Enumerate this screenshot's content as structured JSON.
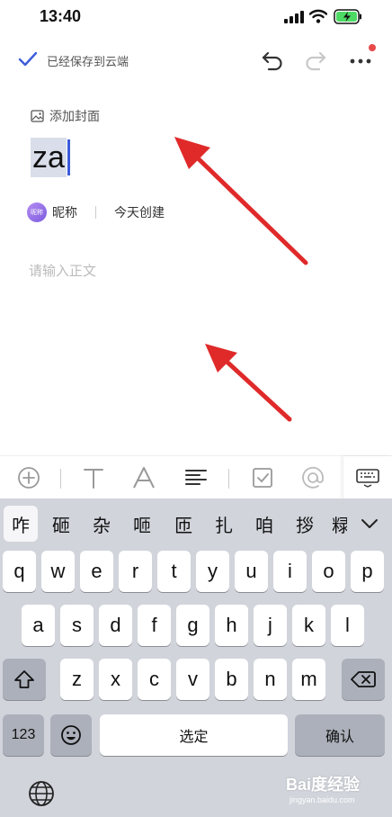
{
  "status_bar": {
    "time": "13:40"
  },
  "toolbar": {
    "save_status": "已经保存到云端"
  },
  "document": {
    "add_cover": "添加封面",
    "title": "za",
    "author_avatar_text": "昵称",
    "author_name": "昵称",
    "created": "今天创建",
    "body_placeholder": "请输入正文"
  },
  "keyboard": {
    "candidates": [
      "咋",
      "砸",
      "杂",
      "咂",
      "匝",
      "扎",
      "咱",
      "拶",
      "粶"
    ],
    "row1": [
      "q",
      "w",
      "e",
      "r",
      "t",
      "y",
      "u",
      "i",
      "o",
      "p"
    ],
    "row2": [
      "a",
      "s",
      "d",
      "f",
      "g",
      "h",
      "j",
      "k",
      "l"
    ],
    "row3": [
      "z",
      "x",
      "c",
      "v",
      "b",
      "n",
      "m"
    ],
    "numbers_key": "123",
    "space_key": "选定",
    "return_key": "确认"
  },
  "watermark": {
    "brand": "Bai度经验",
    "url": "jingyan.baidu.com"
  },
  "colors": {
    "accent": "#3b5bdb",
    "arrow": "#e02a2a",
    "notify": "#e84a4a"
  }
}
